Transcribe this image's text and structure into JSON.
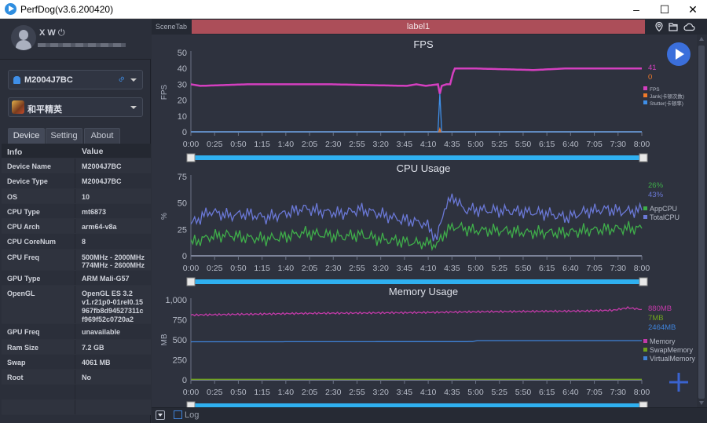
{
  "window": {
    "title": "PerfDog(v3.6.200420)",
    "controls": [
      "minimize",
      "maximize",
      "close"
    ]
  },
  "user": {
    "name": "X W",
    "power_icon": "power-icon"
  },
  "device_select": {
    "value": "M2004J7BC",
    "icon": "android-icon",
    "conn_icon": "usb-link-icon"
  },
  "app_select": {
    "value": "和平精英",
    "icon": "game-app-icon"
  },
  "tabs": [
    {
      "label": "Device",
      "active": true
    },
    {
      "label": "Setting"
    },
    {
      "label": "About"
    }
  ],
  "info_table": {
    "headers": [
      "Info",
      "Value"
    ],
    "rows": [
      {
        "k": "Device Name",
        "v": "M2004J7BC"
      },
      {
        "k": "Device Type",
        "v": "M2004J7BC"
      },
      {
        "k": "OS",
        "v": "10"
      },
      {
        "k": "CPU Type",
        "v": "mt6873"
      },
      {
        "k": "CPU Arch",
        "v": "arm64-v8a"
      },
      {
        "k": "CPU CoreNum",
        "v": "8"
      },
      {
        "k": "CPU Freq",
        "v": "500MHz - 2000MHz\n774MHz - 2600MHz"
      },
      {
        "k": "GPU Type",
        "v": "ARM Mali-G57"
      },
      {
        "k": "OpenGL",
        "v": "OpenGL ES 3.2\nv1.r21p0-01rel0.15\n967fb8d94527311c\nf969f52c0720a2"
      },
      {
        "k": "GPU Freq",
        "v": "unavailable"
      },
      {
        "k": "Ram Size",
        "v": "7.2 GB"
      },
      {
        "k": "Swap",
        "v": "4061 MB"
      },
      {
        "k": "Root",
        "v": "No"
      },
      {
        "k": "",
        "v": ""
      },
      {
        "k": "",
        "v": ""
      }
    ]
  },
  "scene": {
    "tab_label": "SceneTab",
    "label": "label1",
    "icons": [
      "location-icon",
      "folder-icon",
      "cloud-icon"
    ]
  },
  "bottom": {
    "log_label": "Log",
    "log_checked": false
  },
  "colors": {
    "fps": "#d43fbf",
    "jank": "#f07a2a",
    "stutter": "#3f8fe8",
    "app_cpu": "#3fae4a",
    "total_cpu": "#6a78d6",
    "memory": "#c23aa8",
    "swap": "#6fa21e",
    "virtual": "#3f82d8",
    "accent": "#2fb0f0",
    "label_bar": "#ac4e59"
  },
  "chart_data": [
    {
      "type": "line",
      "title": "FPS",
      "ylabel": "FPS",
      "xlabel": "",
      "ylim": [
        0,
        50
      ],
      "yticks": [
        "0",
        "10",
        "20",
        "30",
        "40",
        "50"
      ],
      "xticks": [
        "0:00",
        "0:25",
        "0:50",
        "1:15",
        "1:40",
        "2:05",
        "2:30",
        "2:55",
        "3:20",
        "3:45",
        "4:10",
        "4:35",
        "5:00",
        "5:25",
        "5:50",
        "6:15",
        "6:40",
        "7:05",
        "7:30",
        "8:00"
      ],
      "x_range_s": [
        0,
        480
      ],
      "legend": [
        {
          "name": "FPS",
          "color": "#d43fbf"
        },
        {
          "name": "Jank(卡顿次数)",
          "color": "#f07a2a"
        },
        {
          "name": "Stutter(卡顿率)",
          "color": "#3f8fe8"
        }
      ],
      "current_values": [
        {
          "label": "41",
          "color": "#d43fbf"
        },
        {
          "label": "0",
          "color": "#f07a2a"
        }
      ],
      "series": [
        {
          "name": "FPS",
          "points": [
            [
              0,
              30
            ],
            [
              10,
              29
            ],
            [
              60,
              30
            ],
            [
              150,
              30
            ],
            [
              230,
              29
            ],
            [
              240,
              30
            ],
            [
              250,
              29
            ],
            [
              263,
              30
            ],
            [
              265,
              24
            ],
            [
              267,
              29
            ],
            [
              272,
              30
            ],
            [
              276,
              30
            ],
            [
              279,
              37
            ],
            [
              281,
              40
            ],
            [
              300,
              40
            ],
            [
              365,
              39
            ],
            [
              400,
              40
            ],
            [
              480,
              40
            ]
          ]
        },
        {
          "name": "Jank",
          "points": [
            [
              0,
              0
            ],
            [
              264,
              0
            ],
            [
              265,
              2
            ],
            [
              266,
              0
            ],
            [
              480,
              0
            ]
          ]
        },
        {
          "name": "Stutter",
          "points": [
            [
              0,
              0
            ],
            [
              263,
              0
            ],
            [
              265,
              24
            ],
            [
              267,
              0
            ],
            [
              480,
              0
            ]
          ]
        }
      ],
      "legend_position": "right"
    },
    {
      "type": "line",
      "title": "CPU Usage",
      "ylabel": "%",
      "ylim": [
        0,
        75
      ],
      "yticks": [
        "0",
        "25",
        "50",
        "75"
      ],
      "xticks": [
        "0:00",
        "0:25",
        "0:50",
        "1:15",
        "1:40",
        "2:05",
        "2:30",
        "2:55",
        "3:20",
        "3:45",
        "4:10",
        "4:35",
        "5:00",
        "5:25",
        "5:50",
        "6:15",
        "6:40",
        "7:05",
        "7:30",
        "8:00"
      ],
      "x_range_s": [
        0,
        480
      ],
      "legend": [
        {
          "name": "AppCPU",
          "color": "#3fae4a"
        },
        {
          "name": "TotalCPU",
          "color": "#6a78d6"
        }
      ],
      "current_values": [
        {
          "label": "26%",
          "color": "#3fae4a"
        },
        {
          "label": "43%",
          "color": "#6a78d6"
        }
      ],
      "series": [
        {
          "name": "TotalCPU",
          "points": [
            [
              0,
              30
            ],
            [
              20,
              42
            ],
            [
              40,
              38
            ],
            [
              60,
              40
            ],
            [
              80,
              36
            ],
            [
              100,
              40
            ],
            [
              120,
              45
            ],
            [
              140,
              42
            ],
            [
              160,
              40
            ],
            [
              180,
              44
            ],
            [
              200,
              40
            ],
            [
              220,
              35
            ],
            [
              240,
              32
            ],
            [
              250,
              30
            ],
            [
              262,
              16
            ],
            [
              270,
              46
            ],
            [
              280,
              56
            ],
            [
              290,
              44
            ],
            [
              320,
              43
            ],
            [
              350,
              42
            ],
            [
              380,
              40
            ],
            [
              400,
              36
            ],
            [
              420,
              42
            ],
            [
              440,
              44
            ],
            [
              460,
              42
            ],
            [
              480,
              43
            ]
          ]
        },
        {
          "name": "AppCPU",
          "points": [
            [
              0,
              12
            ],
            [
              20,
              18
            ],
            [
              40,
              20
            ],
            [
              60,
              17
            ],
            [
              80,
              16
            ],
            [
              100,
              18
            ],
            [
              120,
              22
            ],
            [
              140,
              20
            ],
            [
              160,
              18
            ],
            [
              180,
              20
            ],
            [
              200,
              16
            ],
            [
              220,
              14
            ],
            [
              240,
              12
            ],
            [
              255,
              12
            ],
            [
              262,
              10
            ],
            [
              270,
              22
            ],
            [
              280,
              28
            ],
            [
              300,
              24
            ],
            [
              330,
              24
            ],
            [
              360,
              22
            ],
            [
              400,
              22
            ],
            [
              420,
              24
            ],
            [
              440,
              25
            ],
            [
              460,
              26
            ],
            [
              480,
              26
            ]
          ]
        }
      ],
      "legend_position": "right"
    },
    {
      "type": "line",
      "title": "Memory Usage",
      "ylabel": "MB",
      "ylim": [
        0,
        1000
      ],
      "yticks": [
        "0",
        "250",
        "500",
        "750",
        "1,000"
      ],
      "xticks": [
        "0:00",
        "0:25",
        "0:50",
        "1:15",
        "1:40",
        "2:05",
        "2:30",
        "2:55",
        "3:20",
        "3:45",
        "4:10",
        "4:35",
        "5:00",
        "5:25",
        "5:50",
        "6:15",
        "6:40",
        "7:05",
        "7:30",
        "8:00"
      ],
      "x_range_s": [
        0,
        480
      ],
      "legend": [
        {
          "name": "Memory",
          "color": "#c23aa8"
        },
        {
          "name": "SwapMemory",
          "color": "#6fa21e"
        },
        {
          "name": "VirtualMemory",
          "color": "#3f82d8"
        }
      ],
      "current_values": [
        {
          "label": "880MB",
          "color": "#c23aa8"
        },
        {
          "label": "7MB",
          "color": "#6fa21e"
        },
        {
          "label": "2464MB",
          "color": "#3f82d8"
        }
      ],
      "series": [
        {
          "name": "Memory",
          "points": [
            [
              0,
              810
            ],
            [
              60,
              820
            ],
            [
              120,
              830
            ],
            [
              180,
              835
            ],
            [
              240,
              840
            ],
            [
              300,
              850
            ],
            [
              360,
              855
            ],
            [
              420,
              860
            ],
            [
              450,
              870
            ],
            [
              465,
              900
            ],
            [
              480,
              880
            ]
          ]
        },
        {
          "name": "SwapMemory",
          "points": [
            [
              0,
              7
            ],
            [
              480,
              7
            ]
          ]
        },
        {
          "name": "VirtualMemory",
          "points": [
            [
              0,
              475
            ],
            [
              300,
              478
            ],
            [
              305,
              490
            ],
            [
              480,
              490
            ]
          ]
        }
      ],
      "legend_position": "right"
    }
  ]
}
